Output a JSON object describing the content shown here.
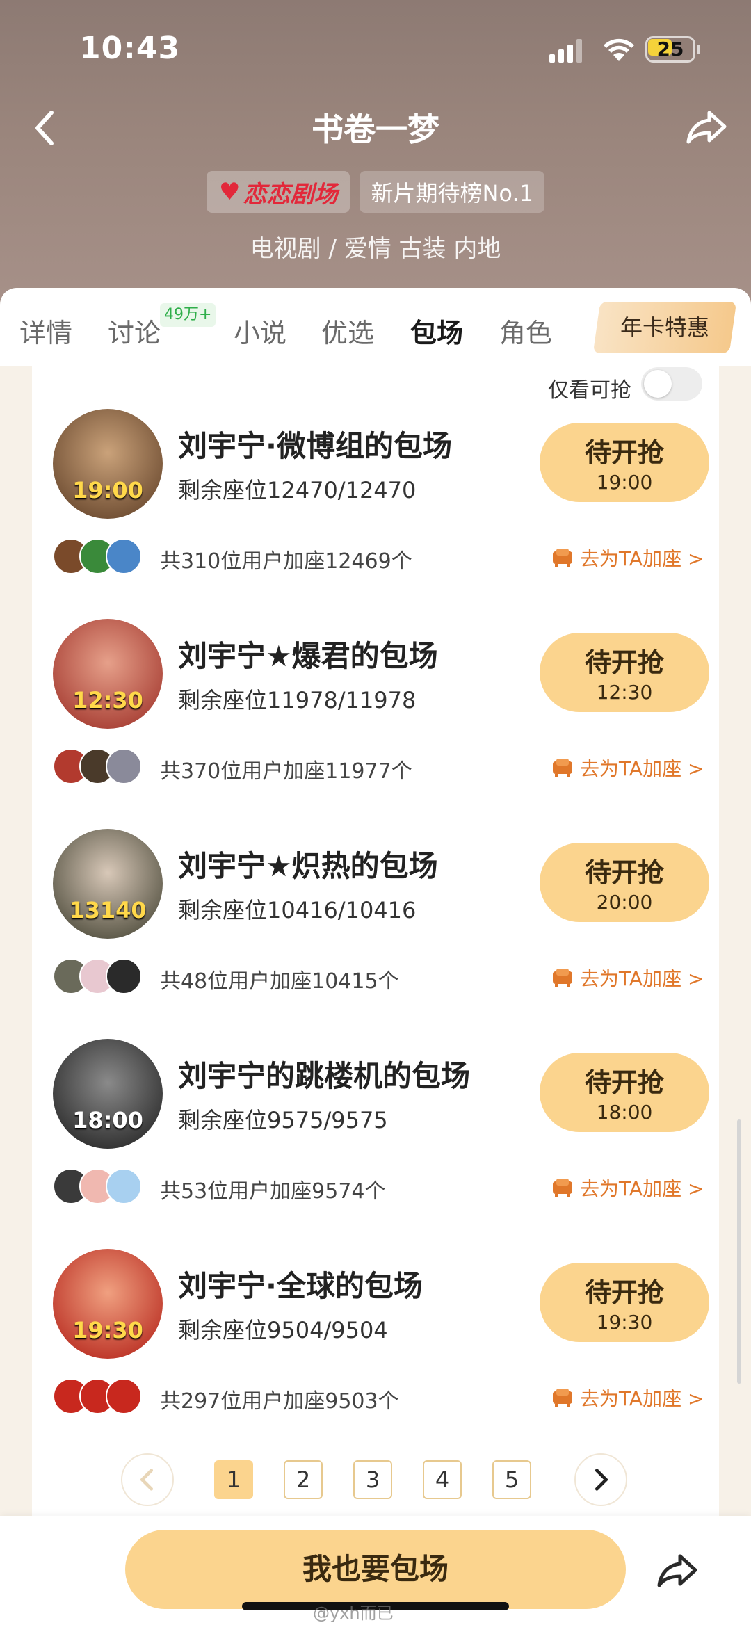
{
  "status": {
    "time": "10:43",
    "battery": "25"
  },
  "header": {
    "title": "书卷一梦",
    "brand_tag": "恋恋剧场",
    "rank_tag": "新片期待榜No.1",
    "genre": "电视剧 / 爱情 古装 内地"
  },
  "tabs": [
    {
      "label": "详情"
    },
    {
      "label": "讨论",
      "badge": "49万+"
    },
    {
      "label": "小说"
    },
    {
      "label": "优选"
    },
    {
      "label": "包场"
    },
    {
      "label": "角色"
    }
  ],
  "annual_card": "年卡特惠",
  "filter": {
    "label": "仅看可抢"
  },
  "items": [
    {
      "title": "刘宇宁·微博组的包场",
      "seats": "剩余座位12470/12470",
      "button": "待开抢",
      "time": "19:00",
      "avatar_time": "19:00",
      "join": "共310位用户加座12469个",
      "link": "去为TA加座 >",
      "avatar_color": "#7a4a2a"
    },
    {
      "title": "刘宇宁★爆君的包场",
      "seats": "剩余座位11978/11978",
      "button": "待开抢",
      "time": "12:30",
      "avatar_time": "12:30",
      "join": "共370位用户加座11977个",
      "link": "去为TA加座 >",
      "avatar_color": "#b23a2e"
    },
    {
      "title": "刘宇宁★炽热的包场",
      "seats": "剩余座位10416/10416",
      "button": "待开抢",
      "time": "20:00",
      "avatar_time": "13140",
      "join": "共48位用户加座10415个",
      "link": "去为TA加座 >",
      "avatar_color": "#4a4a3a"
    },
    {
      "title": "刘宇宁的跳楼机的包场",
      "seats": "剩余座位9575/9575",
      "button": "待开抢",
      "time": "18:00",
      "avatar_time": "18:00",
      "join": "共53位用户加座9574个",
      "link": "去为TA加座 >",
      "avatar_color": "#2a2a2a"
    },
    {
      "title": "刘宇宁·全球的包场",
      "seats": "剩余座位9504/9504",
      "button": "待开抢",
      "time": "19:30",
      "avatar_time": "19:30",
      "join": "共297位用户加座9503个",
      "link": "去为TA加座 >",
      "avatar_color": "#c8281e"
    }
  ],
  "pagination": {
    "pages": [
      "1",
      "2",
      "3",
      "4",
      "5"
    ],
    "current": "1"
  },
  "cta": "我也要包场",
  "watermark": "@yxh而已"
}
